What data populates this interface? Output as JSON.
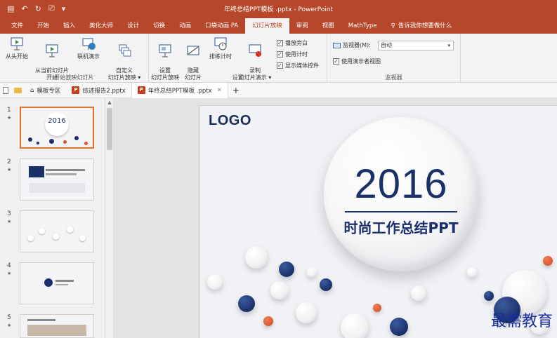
{
  "window": {
    "title": "年终总结PPT模板 .pptx - PowerPoint",
    "qat": [
      "save-icon",
      "undo-icon",
      "redo-icon",
      "start-from-beginning-icon",
      "customize-qat-icon"
    ]
  },
  "tabs": [
    {
      "label": "文件"
    },
    {
      "label": "开始"
    },
    {
      "label": "插入"
    },
    {
      "label": "美化大师"
    },
    {
      "label": "设计"
    },
    {
      "label": "切换"
    },
    {
      "label": "动画"
    },
    {
      "label": "口袋动画 PA"
    },
    {
      "label": "幻灯片放映",
      "active": true
    },
    {
      "label": "审阅"
    },
    {
      "label": "视图"
    },
    {
      "label": "MathType"
    },
    {
      "label": "告诉我你想要做什么"
    }
  ],
  "ribbon": {
    "start_group": {
      "label": "开始放映幻灯片",
      "buttons": [
        {
          "label": "从头开始",
          "icon": "play-from-start-icon"
        },
        {
          "label": "从当前幻灯片\n开始",
          "icon": "play-from-current-icon"
        },
        {
          "label": "联机演示",
          "icon": "present-online-icon"
        },
        {
          "label": "自定义\n幻灯片放映 ▾",
          "icon": "custom-show-icon"
        }
      ]
    },
    "setup_group": {
      "label": "设置",
      "buttons": [
        {
          "label": "设置\n幻灯片放映",
          "icon": "setup-show-icon"
        },
        {
          "label": "隐藏\n幻灯片",
          "icon": "hide-slide-icon"
        },
        {
          "label": "排练计时",
          "icon": "rehearse-timings-icon"
        },
        {
          "label": "录制\n幻灯片演示 ▾",
          "icon": "record-show-icon"
        }
      ],
      "checkboxes": [
        {
          "label": "播放旁白",
          "checked": true
        },
        {
          "label": "使用计时",
          "checked": true
        },
        {
          "label": "显示媒体控件",
          "checked": true
        }
      ]
    },
    "monitor_group": {
      "label": "监视器",
      "monitor_label": "监视器(M):",
      "monitor_value": "自动",
      "presenter_view_label": "使用演示者视图",
      "presenter_view_checked": true
    }
  },
  "doc_tabs": [
    {
      "label": "模板专区"
    },
    {
      "label": "综述报告2.pptx"
    },
    {
      "label": "年终总结PPT模板 .pptx",
      "active": true
    }
  ],
  "thumbnails": [
    {
      "number": "1",
      "selected": true
    },
    {
      "number": "2"
    },
    {
      "number": "3"
    },
    {
      "number": "4"
    },
    {
      "number": "5"
    }
  ],
  "slide": {
    "logo": "LOGO",
    "year": "2016",
    "subtitle": "时尚工作总结PPT"
  },
  "thumb1": {
    "year": "2016"
  },
  "watermark": "最需教育",
  "colors": {
    "accent": "#b7472a",
    "navy": "#1b2f6a",
    "orange": "#d9542a"
  }
}
